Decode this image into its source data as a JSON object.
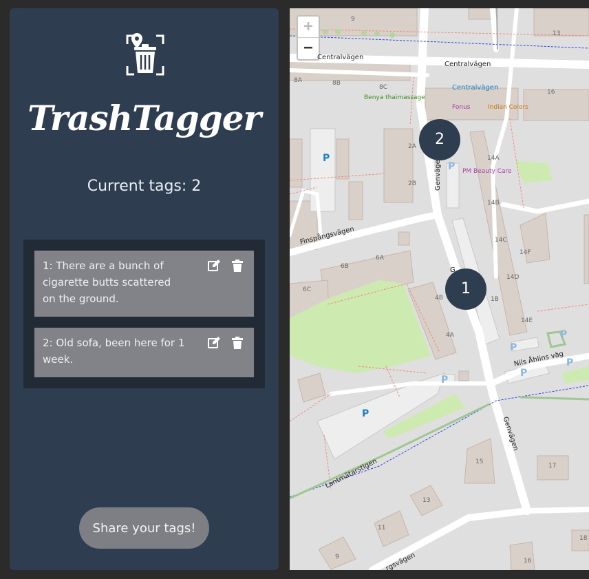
{
  "app": {
    "title": "TrashTagger"
  },
  "tags": {
    "count_text": "Current tags: 2",
    "items": [
      {
        "text": "1: There are a bunch of cigarette butts scattered on the ground."
      },
      {
        "text": "2: Old sofa, been here for 1 week."
      }
    ]
  },
  "share": {
    "label": "Share your tags!"
  },
  "map": {
    "zoom_in": "+",
    "zoom_out": "−",
    "markers": [
      "2",
      "1"
    ],
    "streets": {
      "centralvagen_1": "Centralvägen",
      "centralvagen_2": "Centralvägen",
      "bus_stop": "Centralvägen",
      "finspangsvagen": "Finspångsvägen",
      "genvagen_1": "Genväge",
      "genvagen_2": "G",
      "genvagen_3": "Genvägen",
      "nils_ahlins_vag": "Nils Åhlins väg",
      "lantmatarstigen": "Lantmätarstigen",
      "bottom_road": "rgsvägen"
    },
    "pois": {
      "benya": "Benya thaimassage",
      "fonus": "Fonus",
      "indian": "Indian Colors",
      "pm_beauty": "PM Beauty Care"
    },
    "house_numbers": [
      "9",
      "13",
      "8A",
      "8B",
      "8C",
      "16",
      "2A",
      "2B",
      "14A",
      "14B",
      "14C",
      "14D",
      "14E",
      "14F",
      "6A",
      "6B",
      "6C",
      "4B",
      "4A",
      "1B",
      "15",
      "17",
      "13",
      "11",
      "9",
      "16",
      "18"
    ],
    "parking": "P"
  }
}
